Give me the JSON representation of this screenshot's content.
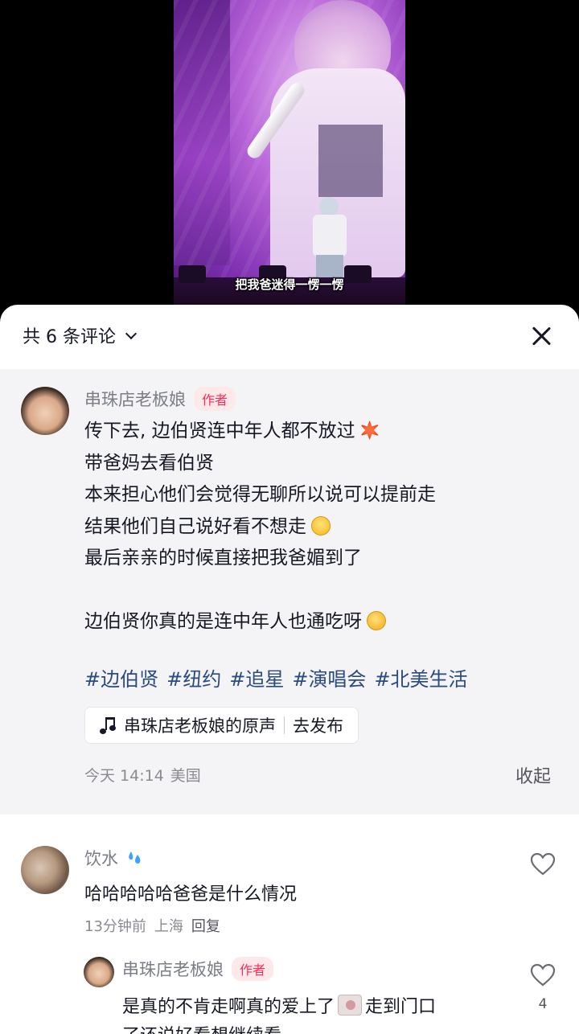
{
  "video": {
    "subtitle": "把我爸迷得一愣一愣"
  },
  "sheet": {
    "comment_count_label": "共 6 条评论",
    "close_icon": "close-icon",
    "dropdown_icon": "chevron-down-icon"
  },
  "pinned": {
    "username": "串珠店老板娘",
    "author_tag": "作者",
    "lines": [
      "传下去, 边伯贤连中年人都不放过",
      "带爸妈去看伯贤",
      "本来担心他们会觉得无聊所以说可以提前走",
      "结果他们自己说好看不想走",
      "最后亲亲的时候直接把我爸媚到了",
      "",
      "边伯贤你真的是连中年人也通吃呀"
    ],
    "emojis": [
      "anger-emoji",
      "smile-emoji",
      "rofl-emoji"
    ],
    "hashtags": [
      "#边伯贤",
      "#纽约",
      "#追星",
      "#演唱会",
      "#北美生活"
    ],
    "music": {
      "title": "串珠店老板娘的原声",
      "action": "去发布"
    },
    "time": "今天 14:14",
    "location": "美国",
    "collapse_label": "收起"
  },
  "comments": [
    {
      "username": "饮水",
      "text": "哈哈哈哈哈爸爸是什么情况",
      "time": "13分钟前",
      "location": "上海",
      "reply_label": "回复"
    }
  ],
  "replies": [
    {
      "username": "串珠店老板娘",
      "author_tag": "作者",
      "text_part1": "是真的不肯走啊真的爱上了",
      "text_part2": "走到门口",
      "text_line2": "了还说好看想继续看",
      "likes": "4"
    }
  ],
  "colors": {
    "author_tag_bg": "#fde8ea",
    "author_tag_text": "#fe2c55",
    "hashtag": "#2b4a7e",
    "pinned_bg": "#f4f4f6"
  }
}
